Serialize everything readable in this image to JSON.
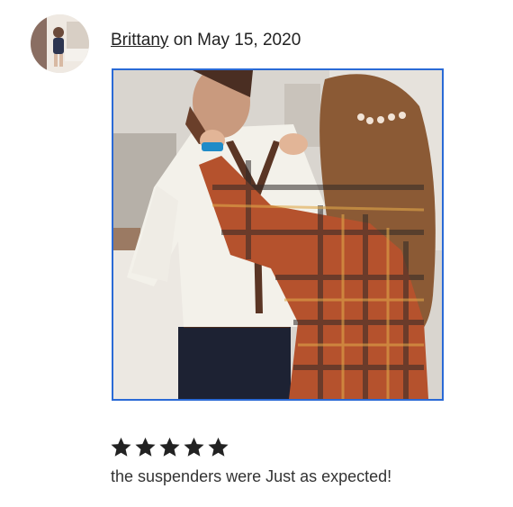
{
  "review": {
    "reviewer_name": "Brittany",
    "date_connector": " on ",
    "date": "May 15, 2020",
    "rating": 5,
    "text": "the suspenders were Just as expected!"
  },
  "icons": {
    "avatar": "reviewer-avatar",
    "star": "star-icon",
    "photo": "review-photo"
  },
  "colors": {
    "star": "#222222",
    "photo_border": "#2a6ad6",
    "text": "#222222"
  }
}
